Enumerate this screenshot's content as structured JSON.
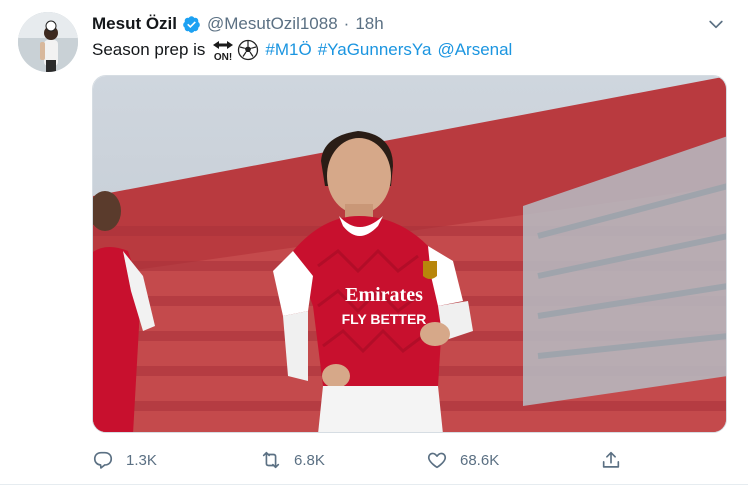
{
  "author": {
    "name": "Mesut Özil",
    "handle": "@MesutOzil1088",
    "separator": "·",
    "time": "18h",
    "verified": true
  },
  "tweet": {
    "text_prefix": "Season prep is",
    "emojis": [
      "on-arrow-emoji",
      "soccer-ball-emoji"
    ],
    "on_label": "ON!",
    "links": [
      "#M1Ö",
      "#YaGunnersYa",
      "@Arsenal"
    ]
  },
  "media": {
    "description": "player-photo",
    "shirt_text_1": "Emirates",
    "shirt_text_2": "FLY BETTER"
  },
  "actions": {
    "replies": "1.3K",
    "retweets": "6.8K",
    "likes": "68.6K"
  },
  "colors": {
    "link": "#1b95e0",
    "verified": "#1da1f2",
    "muted": "#5b7083",
    "kit_red": "#c8102e"
  }
}
